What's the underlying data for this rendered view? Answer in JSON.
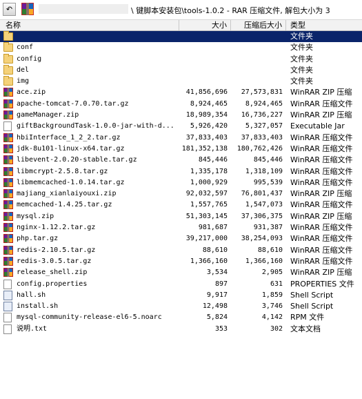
{
  "toolbar": {
    "back_glyph": "↶",
    "address": "\\  键脚本安装包\\tools-1.0.2 - RAR 压缩文件, 解包大小为 3"
  },
  "columns": {
    "name": "名称",
    "size": "大小",
    "packed": "压缩后大小",
    "type": "类型"
  },
  "rows": [
    {
      "name": "",
      "size": "",
      "packed": "",
      "type": "文件夹",
      "icon": "folder",
      "selected": true
    },
    {
      "name": "conf",
      "size": "",
      "packed": "",
      "type": "文件夹",
      "icon": "folder"
    },
    {
      "name": "config",
      "size": "",
      "packed": "",
      "type": "文件夹",
      "icon": "folder"
    },
    {
      "name": "del",
      "size": "",
      "packed": "",
      "type": "文件夹",
      "icon": "folder"
    },
    {
      "name": "img",
      "size": "",
      "packed": "",
      "type": "文件夹",
      "icon": "folder"
    },
    {
      "name": "ace.zip",
      "size": "41,856,696",
      "packed": "27,573,831",
      "type": "WinRAR ZIP 压缩",
      "icon": "archive"
    },
    {
      "name": "apache-tomcat-7.0.70.tar.gz",
      "size": "8,924,465",
      "packed": "8,924,465",
      "type": "WinRAR 压缩文件",
      "icon": "archive"
    },
    {
      "name": "gameManager.zip",
      "size": "18,989,354",
      "packed": "16,736,227",
      "type": "WinRAR ZIP 压缩",
      "icon": "archive"
    },
    {
      "name": "giftBackgroundTask-1.0.0-jar-with-d...",
      "size": "5,926,420",
      "packed": "5,327,057",
      "type": "Executable Jar",
      "icon": "document"
    },
    {
      "name": "hbiInterface_1_2_2.tar.gz",
      "size": "37,833,403",
      "packed": "37,833,403",
      "type": "WinRAR 压缩文件",
      "icon": "archive"
    },
    {
      "name": "jdk-8u101-linux-x64.tar.gz",
      "size": "181,352,138",
      "packed": "180,762,426",
      "type": "WinRAR 压缩文件",
      "icon": "archive"
    },
    {
      "name": "libevent-2.0.20-stable.tar.gz",
      "size": "845,446",
      "packed": "845,446",
      "type": "WinRAR 压缩文件",
      "icon": "archive"
    },
    {
      "name": "libmcrypt-2.5.8.tar.gz",
      "size": "1,335,178",
      "packed": "1,318,109",
      "type": "WinRAR 压缩文件",
      "icon": "archive"
    },
    {
      "name": "libmemcached-1.0.14.tar.gz",
      "size": "1,000,929",
      "packed": "995,539",
      "type": "WinRAR 压缩文件",
      "icon": "archive"
    },
    {
      "name": "majiang_xianlaiyouxi.zip",
      "size": "92,032,597",
      "packed": "76,801,437",
      "type": "WinRAR ZIP 压缩",
      "icon": "archive"
    },
    {
      "name": "memcached-1.4.25.tar.gz",
      "size": "1,557,765",
      "packed": "1,547,073",
      "type": "WinRAR 压缩文件",
      "icon": "archive"
    },
    {
      "name": "mysql.zip",
      "size": "51,303,145",
      "packed": "37,306,375",
      "type": "WinRAR ZIP 压缩",
      "icon": "archive"
    },
    {
      "name": "nginx-1.12.2.tar.gz",
      "size": "981,687",
      "packed": "931,387",
      "type": "WinRAR 压缩文件",
      "icon": "archive"
    },
    {
      "name": "php.tar.gz",
      "size": "39,217,000",
      "packed": "38,254,093",
      "type": "WinRAR 压缩文件",
      "icon": "archive"
    },
    {
      "name": "redis-2.10.5.tar.gz",
      "size": "88,610",
      "packed": "88,610",
      "type": "WinRAR 压缩文件",
      "icon": "archive"
    },
    {
      "name": "redis-3.0.5.tar.gz",
      "size": "1,366,160",
      "packed": "1,366,160",
      "type": "WinRAR 压缩文件",
      "icon": "archive"
    },
    {
      "name": "release_shell.zip",
      "size": "3,534",
      "packed": "2,905",
      "type": "WinRAR ZIP 压缩",
      "icon": "archive"
    },
    {
      "name": "config.properties",
      "size": "897",
      "packed": "631",
      "type": "PROPERTIES 文件",
      "icon": "document"
    },
    {
      "name": "hall.sh",
      "size": "9,917",
      "packed": "1,859",
      "type": "Shell Script",
      "icon": "shell"
    },
    {
      "name": "install.sh",
      "size": "12,498",
      "packed": "3,746",
      "type": "Shell Script",
      "icon": "shell"
    },
    {
      "name": "mysql-community-release-el6-5.noarc",
      "size": "5,824",
      "packed": "4,142",
      "type": "RPM 文件",
      "icon": "document"
    },
    {
      "name": "说明.txt",
      "size": "353",
      "packed": "302",
      "type": "文本文档",
      "icon": "document"
    }
  ]
}
